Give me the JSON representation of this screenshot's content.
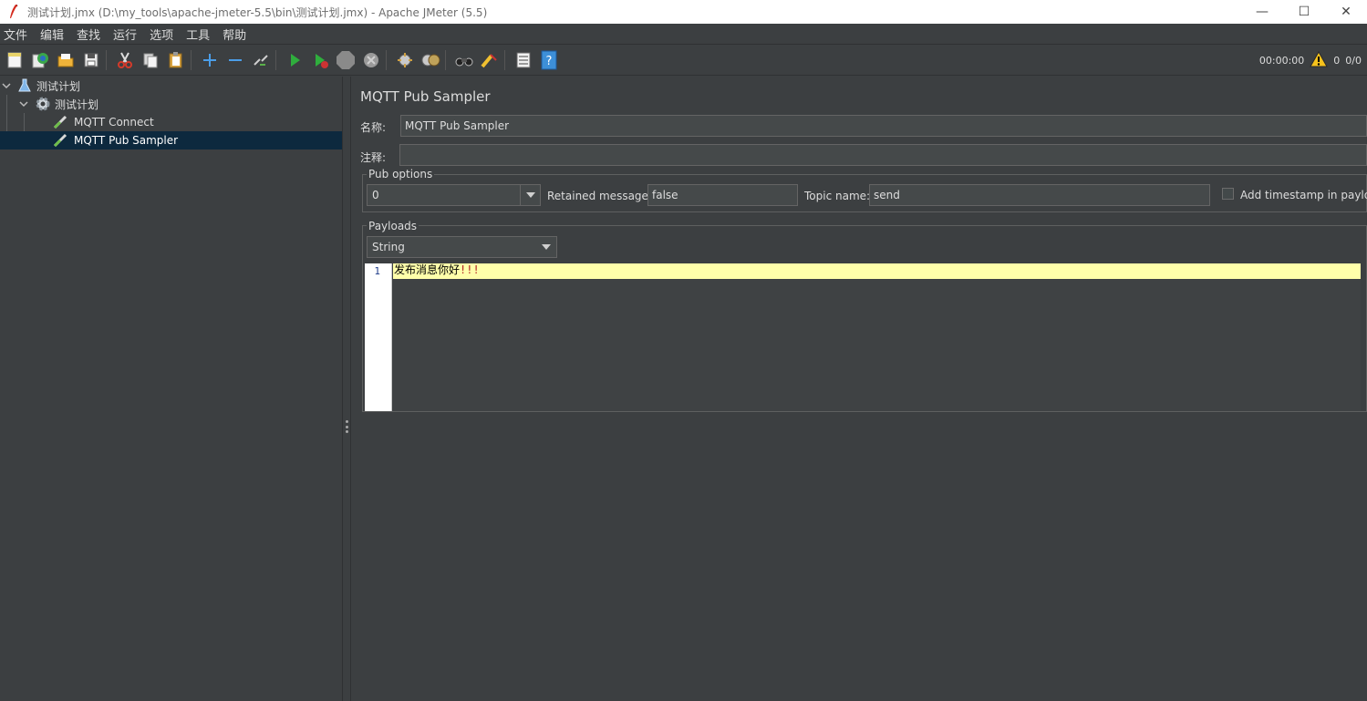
{
  "window": {
    "title": "测试计划.jmx (D:\\my_tools\\apache-jmeter-5.5\\bin\\测试计划.jmx) - Apache JMeter (5.5)",
    "minimize": "—",
    "maximize": "☐",
    "close": "✕"
  },
  "menu": [
    "文件",
    "编辑",
    "查找",
    "运行",
    "选项",
    "工具",
    "帮助"
  ],
  "toolbar": {
    "timer": "00:00:00",
    "warnings": "0",
    "threads": "0/0",
    "icons": [
      "new-icon",
      "templates-icon",
      "open-icon",
      "save-icon",
      "cut-icon",
      "copy-icon",
      "paste-icon",
      "expand-icon",
      "collapse-icon",
      "toggle-icon",
      "start-icon",
      "start-no-pause-icon",
      "stop-icon",
      "shutdown-icon",
      "clear-icon",
      "clear-all-icon",
      "search-icon",
      "reset-search-icon",
      "function-helper-icon",
      "help-icon"
    ]
  },
  "tree": {
    "items": [
      {
        "label": "测试计划",
        "icon": "flask-icon",
        "level": 0,
        "expanded": true
      },
      {
        "label": "测试计划",
        "icon": "gear-icon",
        "level": 1,
        "expanded": true
      },
      {
        "label": "MQTT Connect",
        "icon": "pipette-icon",
        "level": 2
      },
      {
        "label": "MQTT Pub Sampler",
        "icon": "pipette-icon",
        "level": 2,
        "selected": true
      }
    ]
  },
  "sampler": {
    "heading": "MQTT Pub Sampler",
    "name_label": "名称:",
    "name_value": "MQTT Pub Sampler",
    "comment_label": "注释:",
    "comment_value": "",
    "pub_options": {
      "title": "Pub options",
      "qos_value": "0",
      "retained_label": "Retained messages:",
      "retained_value": "false",
      "topic_label": "Topic name:",
      "topic_value": "send",
      "timestamp_label": "Add timestamp in payload",
      "timestamp_checked": false
    },
    "payloads": {
      "title": "Payloads",
      "type_value": "String",
      "line_number": "1",
      "text": "发布消息你好",
      "text_punct": "!!!"
    }
  }
}
